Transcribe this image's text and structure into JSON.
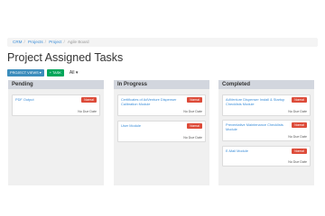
{
  "breadcrumb": [
    "CRM",
    "Projects",
    "Project",
    "Agile Board"
  ],
  "page_title": "Project Assigned Tasks",
  "toolbar": {
    "views_label": "PROJECT VIEWS ▾",
    "task_label": "+ TASK",
    "filter_label": "All ▾"
  },
  "columns": [
    {
      "title": "Pending",
      "cards": [
        {
          "title": "PDF Output",
          "badge": "Normal",
          "due": "No Due Date"
        }
      ]
    },
    {
      "title": "In Progress",
      "cards": [
        {
          "title": "Certificates of AdVenture Dispenser Calibration Module",
          "badge": "Normal",
          "due": "No Due Date"
        },
        {
          "title": "User Module",
          "badge": "Normal",
          "due": "No Due Date"
        }
      ]
    },
    {
      "title": "Completed",
      "cards": [
        {
          "title": "AdVenture Dispenser Install & Startup Checklists Module",
          "badge": "Normal",
          "due": "No Due Date"
        },
        {
          "title": "Preventative Maintenance Checklists Module",
          "badge": "Normal",
          "due": "No Due Date"
        },
        {
          "title": "E-Mail Module",
          "badge": "Normal",
          "due": "No Due Date"
        }
      ]
    }
  ],
  "colors": {
    "link": "#3a8dd8",
    "badge": "#dd4b39",
    "views_button": "#3c8dbc",
    "task_button": "#00a65a",
    "column_header": "#d2d6de"
  }
}
